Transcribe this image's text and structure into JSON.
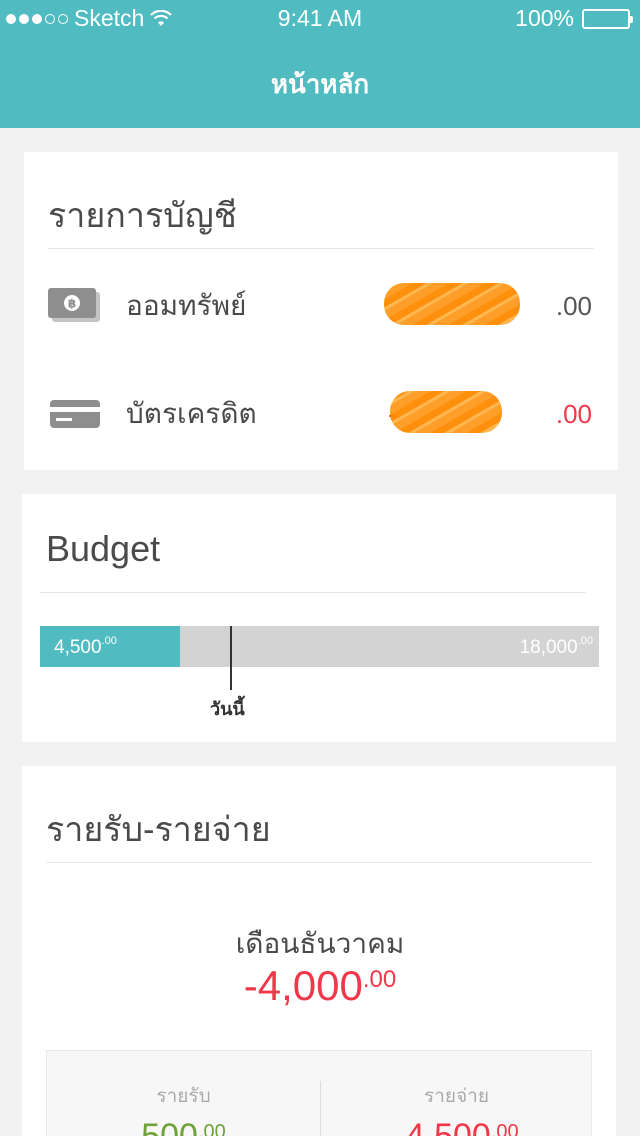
{
  "status_bar": {
    "carrier": "Sketch",
    "time": "9:41 AM",
    "battery": "100%"
  },
  "header": {
    "title": "หน้าหลัก"
  },
  "accounts": {
    "title": "รายการบัญชี",
    "items": [
      {
        "name": "ออมทรัพย์",
        "icon": "cash-icon",
        "amount_cents": ".00",
        "amount_prefix": ""
      },
      {
        "name": "บัตรเครดิต",
        "icon": "credit-card-icon",
        "amount_cents": ".00",
        "amount_prefix": "-"
      }
    ]
  },
  "budget": {
    "title": "Budget",
    "spent": "4,500",
    "spent_cents": ".00",
    "total": "18,000",
    "total_cents": ".00",
    "spent_fraction": 0.25,
    "today_label": "วันนี้"
  },
  "income_expense": {
    "title": "รายรับ-รายจ่าย",
    "month": "เดือนธันวาคม",
    "net": "-4,000",
    "net_cents": ".00",
    "income_label": "รายรับ",
    "income": "500",
    "income_cents": ".00",
    "expense_label": "รายจ่าย",
    "expense": "-4,500",
    "expense_cents": ".00"
  },
  "colors": {
    "accent": "#50bcc2",
    "negative": "#f0384a",
    "positive": "#6fa23a",
    "redaction": "#ff9a1f"
  }
}
